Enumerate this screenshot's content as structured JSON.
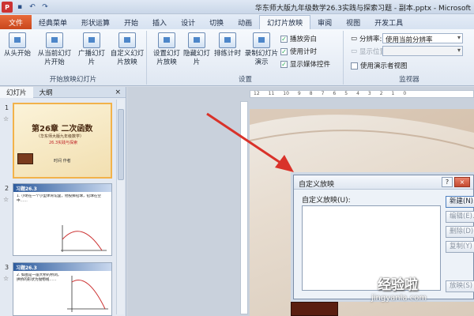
{
  "window": {
    "title": "华东师大版九年级数学26.3实践与探索习题 - 副本.pptx - Microsoft"
  },
  "tabs": [
    "文件",
    "经典菜单",
    "形状运算",
    "开始",
    "插入",
    "设计",
    "切换",
    "动画",
    "幻灯片放映",
    "审阅",
    "视图",
    "开发工具"
  ],
  "active_tab": "幻灯片放映",
  "ribbon": {
    "group_start": {
      "label": "开始放映幻灯片",
      "buttons": [
        "从头开始",
        "从当前幻灯片开始",
        "广播幻灯片",
        "自定义幻灯片放映"
      ]
    },
    "group_setup": {
      "label": "设置",
      "buttons": [
        "设置幻灯片放映",
        "隐藏幻灯片",
        "排练计时",
        "录制幻灯片演示"
      ],
      "checks": [
        {
          "label": "播放旁白",
          "checked": true
        },
        {
          "label": "使用计时",
          "checked": true
        },
        {
          "label": "显示媒体控件",
          "checked": true
        }
      ]
    },
    "group_monitor": {
      "label": "监视器",
      "resolution_label": "分辨率:",
      "resolution_value": "使用当前分辨率",
      "show_on_label": "显示位置:",
      "presenter_view": "使用演示者视图"
    }
  },
  "pane": {
    "tabs": [
      "幻灯片",
      "大纲"
    ],
    "close": "×",
    "slides": [
      {
        "num": "1",
        "title": "第26章 二次函数",
        "subtitle": "（华东师大版九年级数学）",
        "tag": "26.3实践与探索",
        "footer": "时间 作者"
      },
      {
        "num": "2",
        "title": "习题26.3",
        "text": "1. 小明在一个小型体育馆里，他投掷铅球，铅球在空中……"
      },
      {
        "num": "3",
        "title": "习题26.3",
        "text": "2. 如图是一座大桥的桥洞，拱桥的形状为抛物线……"
      }
    ]
  },
  "dialog": {
    "title": "自定义放映",
    "help": "?",
    "close": "×",
    "list_label": "自定义放映(U):",
    "buttons": [
      "新建(N)...",
      "编辑(E)...",
      "删除(D)",
      "复制(Y)",
      "放映(S)"
    ]
  },
  "watermark": {
    "text": "经验啦",
    "sub": "jingyanla.com"
  },
  "colors": {
    "arrow": "#d9322a",
    "file_tab": "#d9572b"
  }
}
